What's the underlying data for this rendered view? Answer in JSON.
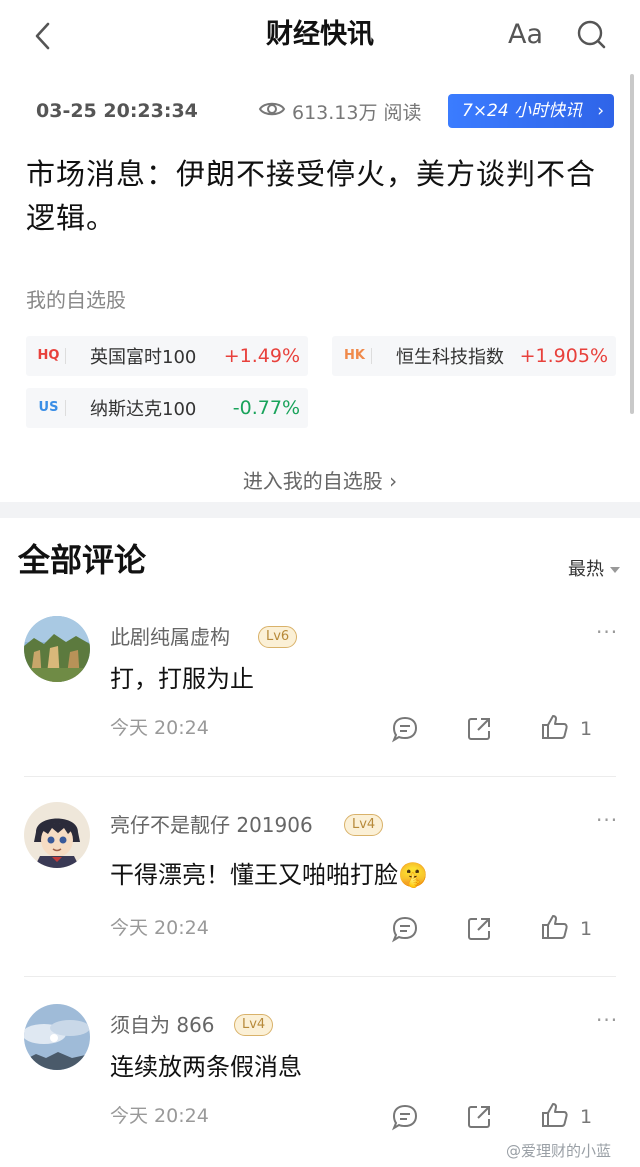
{
  "header": {
    "title": "财经快讯",
    "font_label": "Aa"
  },
  "news": {
    "timestamp": "03-25 20:23:34",
    "views": "613.13万 阅读",
    "badge": "7×24 小时快讯",
    "headline": "市场消息：伊朗不接受停火，美方谈判不合逻辑。"
  },
  "watchlist": {
    "title": "我的自选股",
    "stocks": [
      {
        "market": "HQ",
        "name": "英国富时100",
        "change": "+1.49%",
        "direction": "up"
      },
      {
        "market": "HK",
        "name": "恒生科技指数",
        "change": "+1.905%",
        "direction": "up"
      },
      {
        "market": "US",
        "name": "纳斯达克100",
        "change": "-0.77%",
        "direction": "down"
      }
    ],
    "enter_label": "进入我的自选股 ›"
  },
  "comments_section": {
    "title": "全部评论",
    "sort_label": "最热",
    "comments": [
      {
        "user": "此剧纯属虚构",
        "level": "Lv6",
        "text": "打，打服为止",
        "time": "今天 20:24",
        "likes": "1",
        "avatar": "mountain-photo"
      },
      {
        "user": "亮仔不是靓仔 201906",
        "level": "Lv4",
        "text": "干得漂亮！懂王又啪啪打脸🤫",
        "time": "今天 20:24",
        "likes": "1",
        "avatar": "anime-character"
      },
      {
        "user": "须自为 866",
        "level": "Lv4",
        "text": "连续放两条假消息",
        "time": "今天 20:24",
        "likes": "1",
        "avatar": "sky-photo"
      }
    ]
  },
  "watermark": "@爱理财的小蓝",
  "colors": {
    "up": "#e8413c",
    "down": "#19a35b",
    "badge_blue": "#2f64e8",
    "level_gold": "#b78a3a"
  }
}
